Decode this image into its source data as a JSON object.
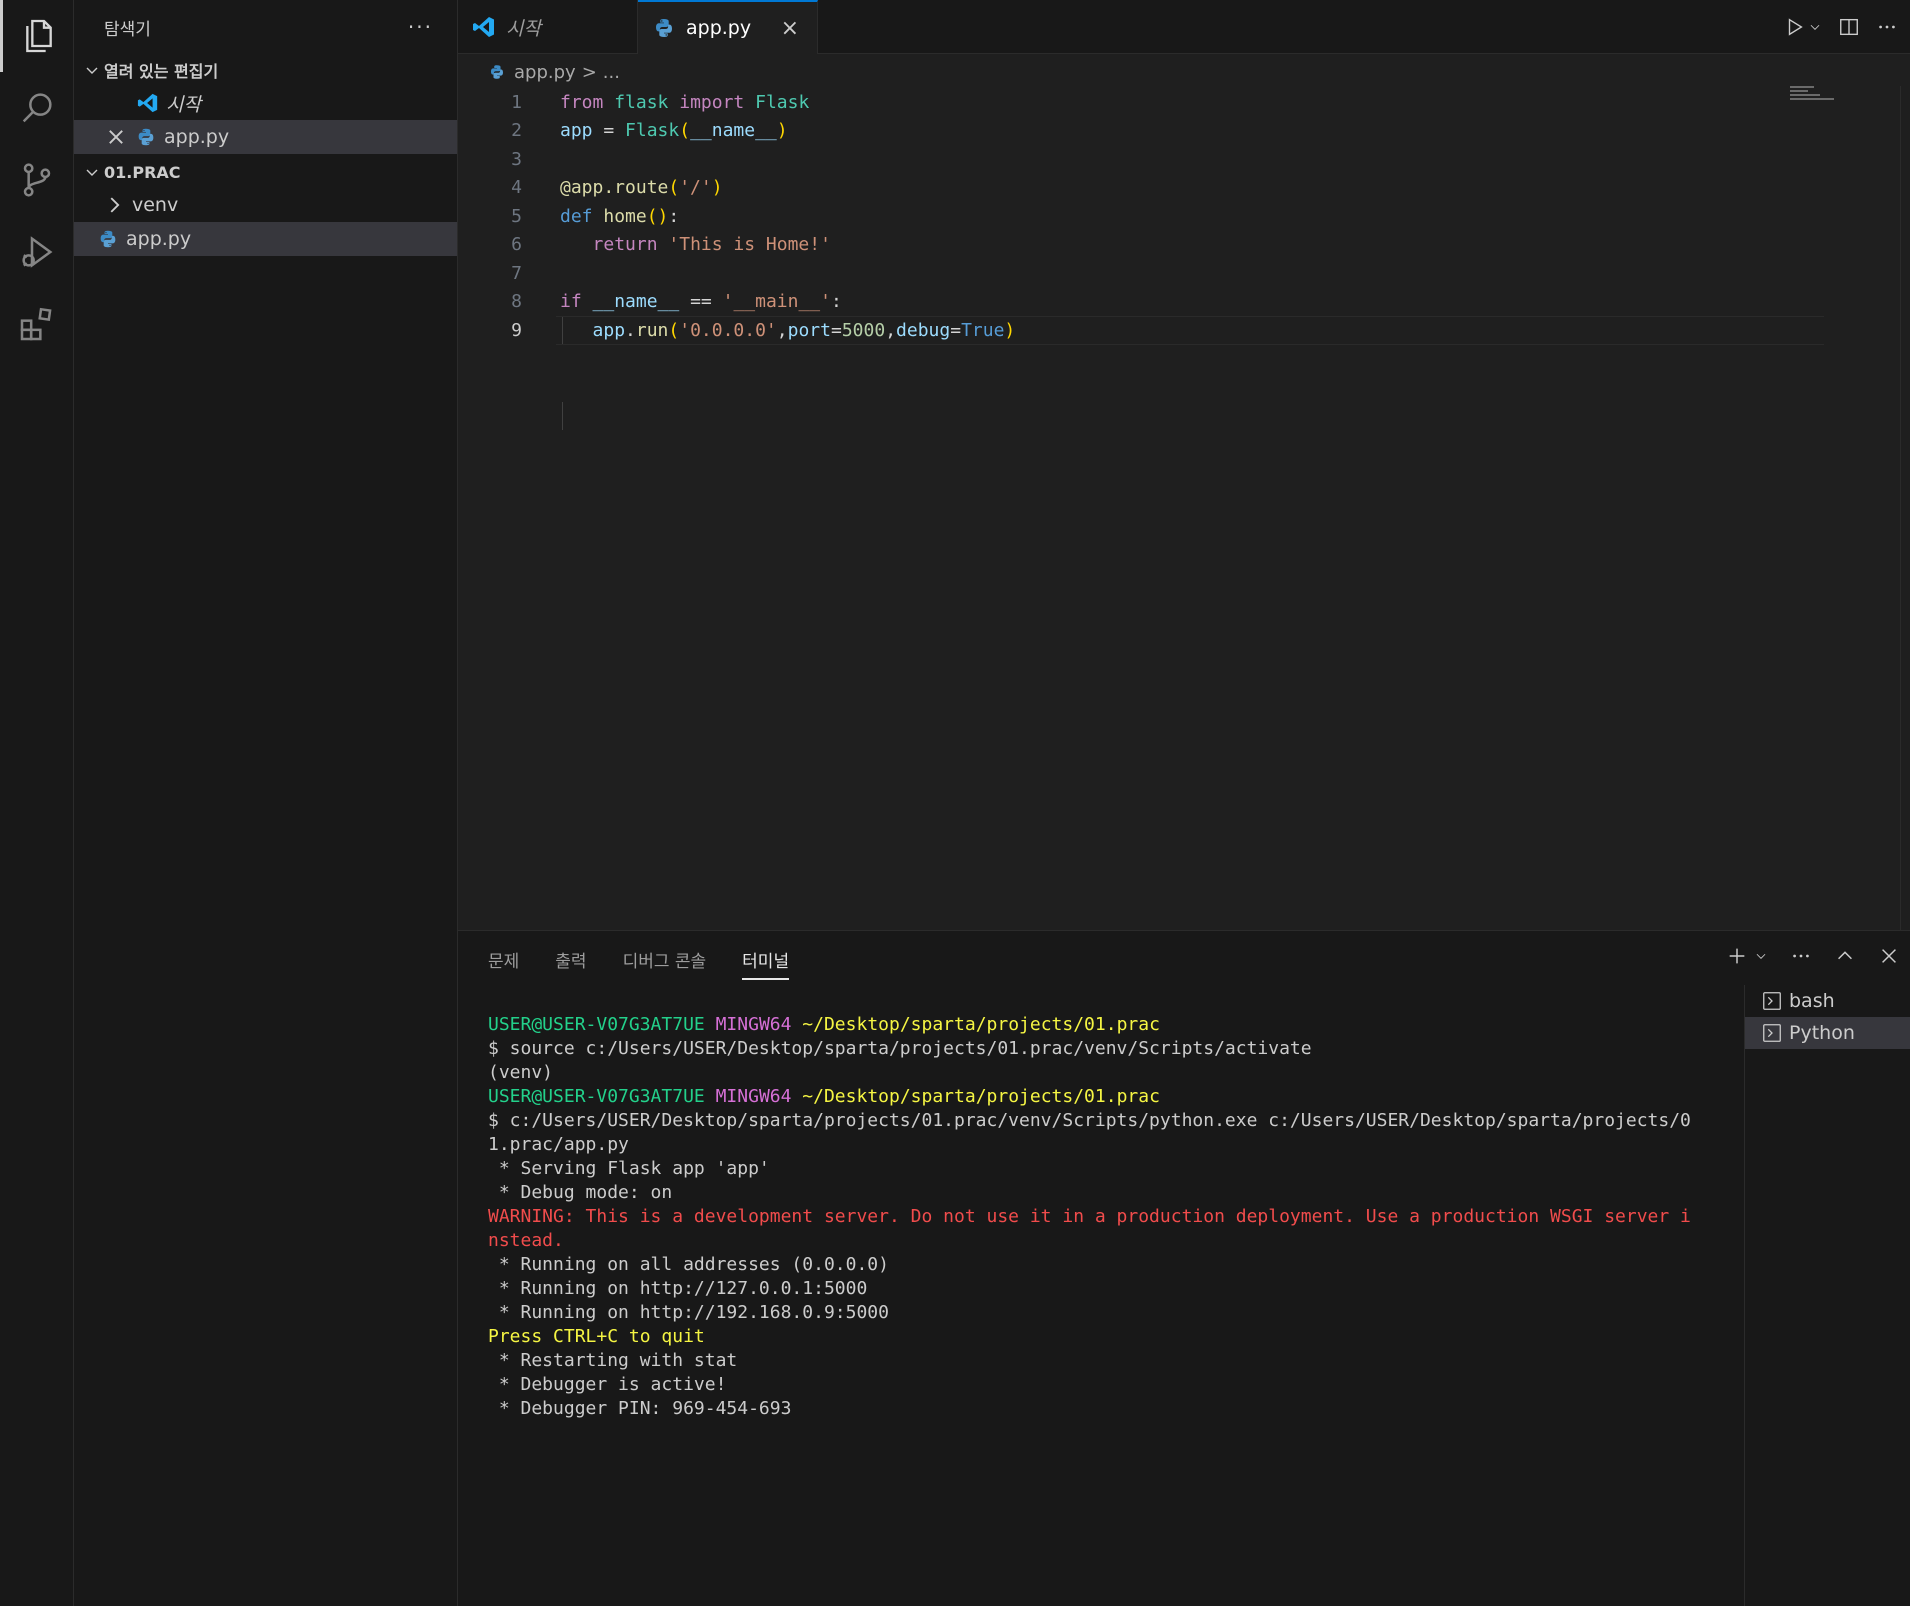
{
  "sidebar": {
    "title": "탐색기",
    "more": "···",
    "open_editors": {
      "label": "열려 있는 편집기",
      "items": [
        {
          "label": "시작"
        },
        {
          "label": "app.py"
        }
      ]
    },
    "folder": {
      "label": "01.PRAC",
      "items": [
        {
          "label": "venv"
        },
        {
          "label": "app.py"
        }
      ]
    }
  },
  "tabs": [
    {
      "label": "시작"
    },
    {
      "label": "app.py",
      "close": "×"
    }
  ],
  "breadcrumb": {
    "file": "app.py",
    "sep": ">",
    "rest": "..."
  },
  "code": {
    "line_numbers": [
      "1",
      "2",
      "3",
      "4",
      "5",
      "6",
      "7",
      "8",
      "9"
    ]
  },
  "panel": {
    "tabs": [
      "문제",
      "출력",
      "디버그 콘솔",
      "터미널"
    ],
    "terminals": [
      "bash",
      "Python"
    ]
  },
  "terminal": {
    "prompt_user": "USER@USER-V07G3AT7UE",
    "prompt_env": "MINGW64",
    "prompt_path": "~/Desktop/sparta/projects/01.prac",
    "cmd1": "$ source c:/Users/USER/Desktop/sparta/projects/01.prac/venv/Scripts/activate",
    "venv": "(venv)",
    "cmd2a": "$ c:/Users/USER/Desktop/sparta/projects/01.prac/venv/Scripts/python.exe c:/Users/USER/Desktop/sparta/projects/0",
    "cmd2b": "1.prac/app.py",
    "out1": " * Serving Flask app 'app'",
    "out2": " * Debug mode: on",
    "warn1": "WARNING: This is a development server. Do not use it in a production deployment. Use a production WSGI server i",
    "warn2": "nstead.",
    "out3": " * Running on all addresses (0.0.0.0)",
    "out4": " * Running on http://127.0.0.1:5000",
    "out5": " * Running on http://192.168.0.9:5000",
    "quit": "Press CTRL+C to quit",
    "out6": " * Restarting with stat",
    "out7": " * Debugger is active!",
    "out8": " * Debugger PIN: 969-454-693"
  }
}
